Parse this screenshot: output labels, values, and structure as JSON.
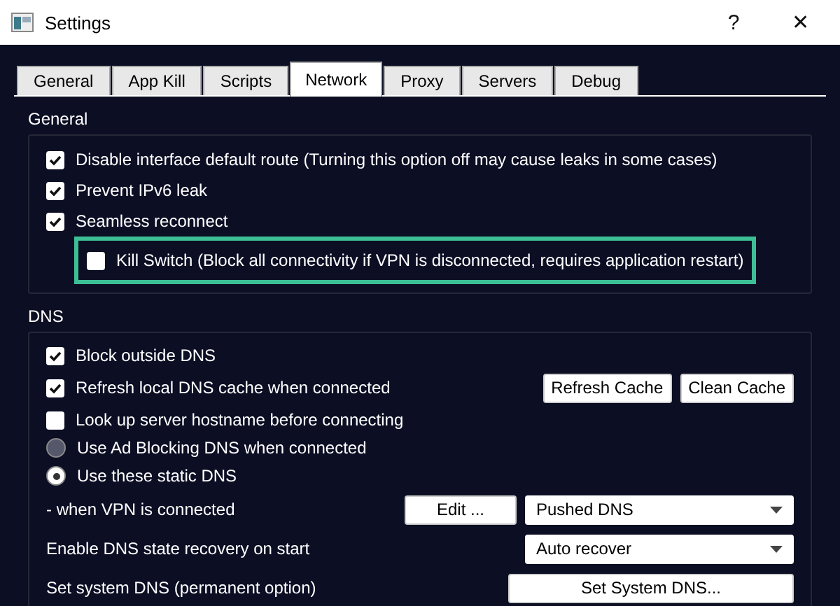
{
  "window": {
    "title": "Settings",
    "help": "?",
    "close": "✕"
  },
  "tabs": [
    {
      "label": "General",
      "selected": false
    },
    {
      "label": "App Kill",
      "selected": false
    },
    {
      "label": "Scripts",
      "selected": false
    },
    {
      "label": "Network",
      "selected": true
    },
    {
      "label": "Proxy",
      "selected": false
    },
    {
      "label": "Servers",
      "selected": false
    },
    {
      "label": "Debug",
      "selected": false
    }
  ],
  "general": {
    "title": "General",
    "options": [
      {
        "label": "Disable interface default route (Turning this option off may cause leaks in some cases)",
        "checked": true
      },
      {
        "label": "Prevent IPv6 leak",
        "checked": true
      },
      {
        "label": "Seamless reconnect",
        "checked": true,
        "children": [
          {
            "label": "Kill Switch (Block all connectivity if VPN is disconnected, requires application restart)",
            "checked": false,
            "highlighted": true
          }
        ]
      }
    ]
  },
  "dns": {
    "title": "DNS",
    "options": [
      {
        "kind": "checkbox",
        "label": "Block outside DNS",
        "checked": true
      },
      {
        "kind": "checkbox",
        "label": "Refresh local DNS cache when connected",
        "checked": true,
        "buttons": [
          "Refresh Cache",
          "Clean Cache"
        ]
      },
      {
        "kind": "checkbox",
        "label": "Look up server hostname before connecting",
        "checked": false
      },
      {
        "kind": "radio",
        "label": "Use Ad Blocking DNS when connected",
        "selected": false
      },
      {
        "kind": "radio",
        "label": "Use these static DNS",
        "selected": true
      }
    ],
    "settings": [
      {
        "label": "- when VPN is connected",
        "button": "Edit ...",
        "dropdown": "Pushed DNS"
      },
      {
        "label": "Enable DNS state recovery on start",
        "dropdown": "Auto recover"
      },
      {
        "label": "Set system DNS (permanent option)",
        "wide_button": "Set System DNS..."
      }
    ]
  }
}
